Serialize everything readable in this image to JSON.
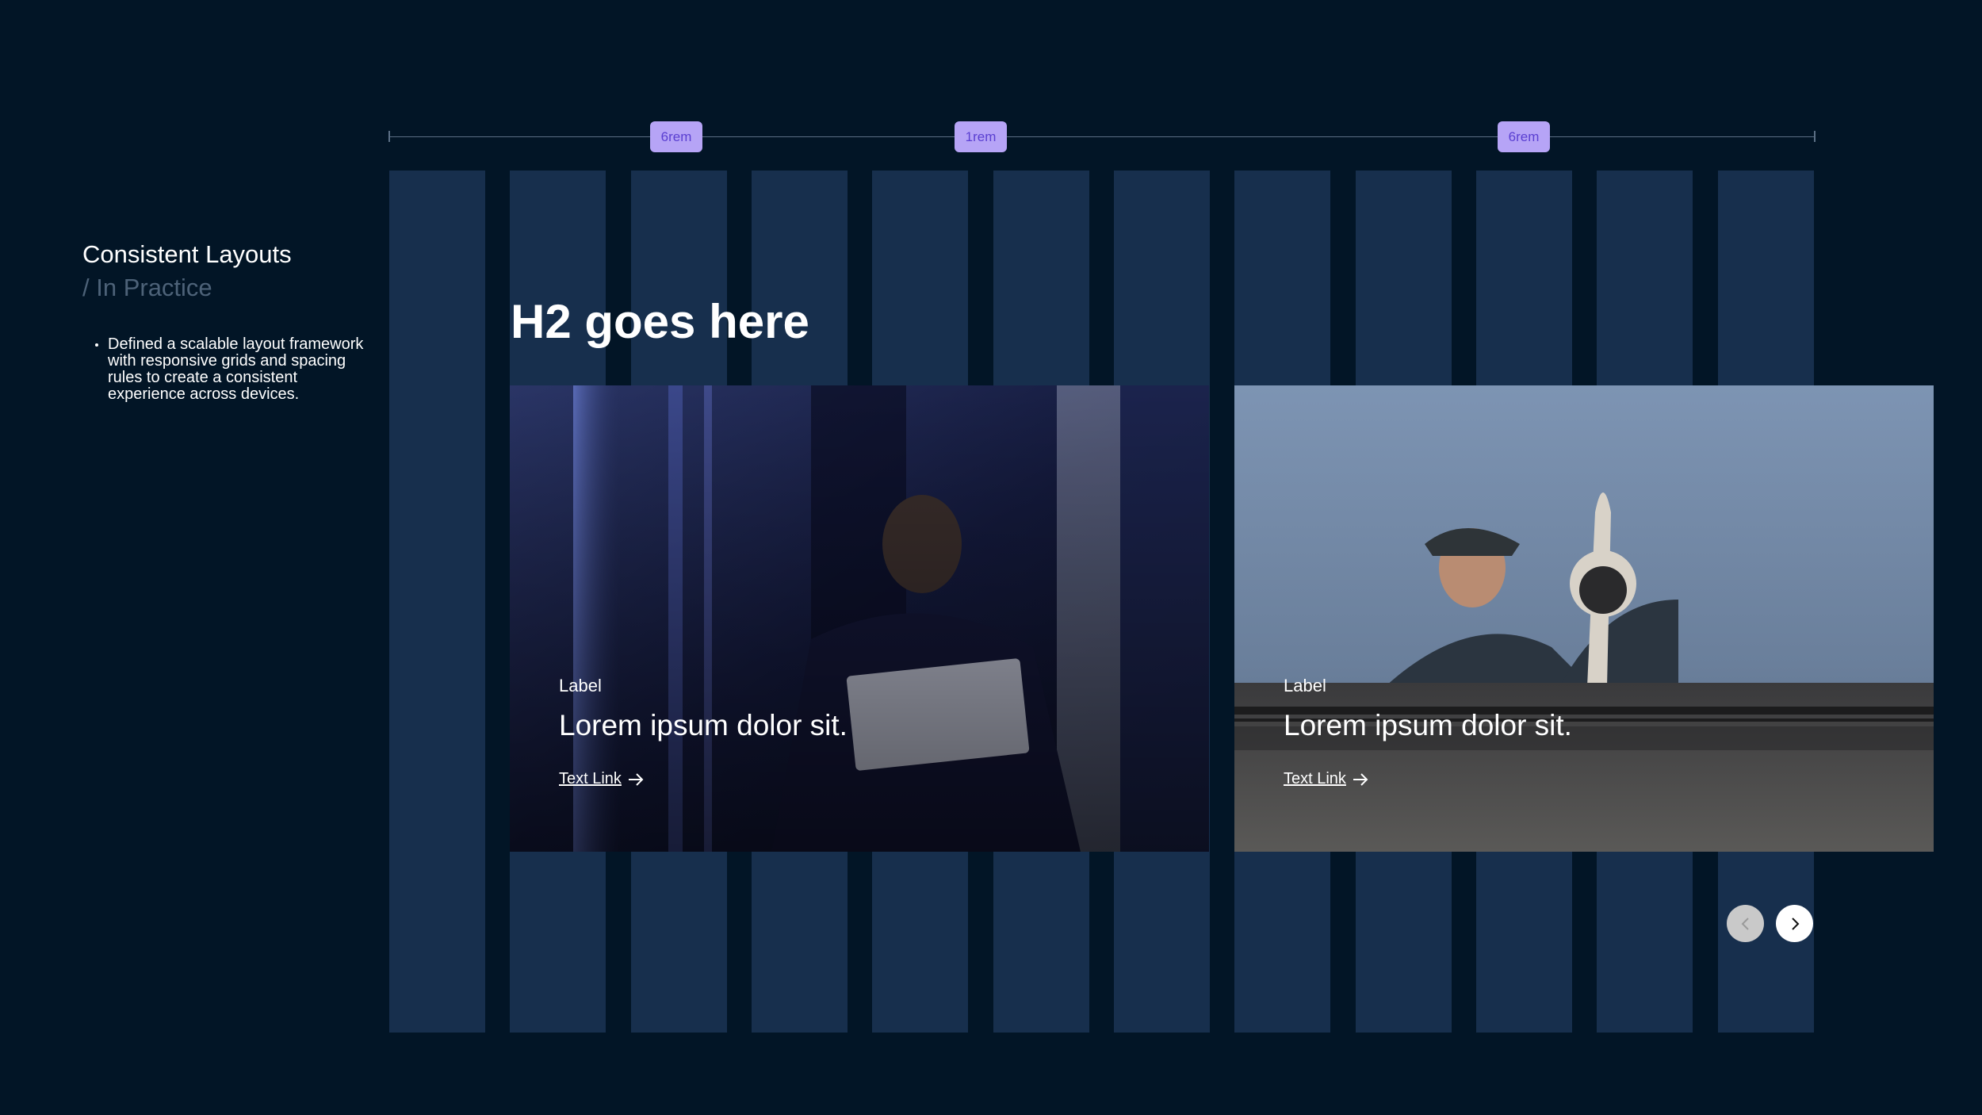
{
  "sidebar": {
    "title": "Consistent Layouts",
    "subtitle": "/ In Practice",
    "bullets": [
      "Defined a scalable layout framework with responsive grids and spacing rules to create a consistent experience across devices."
    ]
  },
  "ruler": {
    "tags": [
      "6rem",
      "1rem",
      "6rem"
    ]
  },
  "main": {
    "heading": "H2 goes here"
  },
  "cards": [
    {
      "label": "Label",
      "title": "Lorem ipsum dolor sit.",
      "link": "Text Link",
      "image": "technician-with-laptop-in-server-room"
    },
    {
      "label": "Label",
      "title": "Lorem ipsum dolor sit.",
      "link": "Text Link",
      "image": "technician-installing-rooftop-camera"
    }
  ],
  "carousel": {
    "prev_icon": "chevron-left-icon",
    "next_icon": "chevron-right-icon"
  },
  "colors": {
    "background": "#021526",
    "grid_column": "#172f4d",
    "tag_background": "#b6a4f6",
    "tag_text": "#5a3fd1"
  }
}
